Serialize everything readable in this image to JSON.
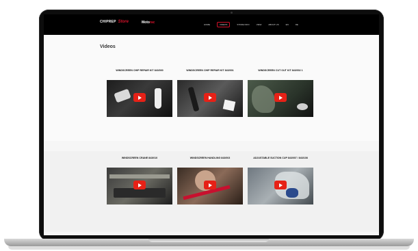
{
  "header": {
    "logo_main": "CHIPREP",
    "logo_sub": "Store",
    "brand_name": "Moto",
    "brand_accent": "rac",
    "nav": [
      "HOME",
      "VIDEOS",
      "STORE INFO",
      "VIEW",
      "ABOUT US",
      "EN",
      "DE"
    ]
  },
  "page": {
    "title": "Videos"
  },
  "videos": [
    {
      "title": "WINDSCREEN CHIP REPAIR KIT 843/000"
    },
    {
      "title": "WINDSCREEN CHIP REPAIR KIT 843/001"
    },
    {
      "title": "WINDSCREEN CUT OUT KIT 843/002 1"
    },
    {
      "title": "WINDSCREEN CRANE 843/010"
    },
    {
      "title": "WINDSCREEN HANDLING 843/003"
    },
    {
      "title": "ADJUSTABLE SUCTION CUP 843/007 / 843/108"
    }
  ],
  "colors": {
    "accent": "#d3122a",
    "play_button": "#e62117",
    "header_bg": "#000000"
  }
}
